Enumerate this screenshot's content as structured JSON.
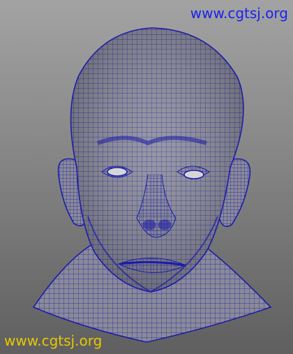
{
  "viewport": {
    "background_top": "#a3a3a3",
    "background_bottom": "#5f5f5f"
  },
  "model": {
    "surface_color": "#8a8a98",
    "wireframe_color": "#1c1ca8",
    "display_mode": "wireframe on shaded"
  },
  "watermarks": {
    "top_right": "www.cgtsj.org",
    "bottom_left": "www.cgtsj.org",
    "top_right_color": "#1a22ee",
    "bottom_left_color": "#e8c800"
  }
}
